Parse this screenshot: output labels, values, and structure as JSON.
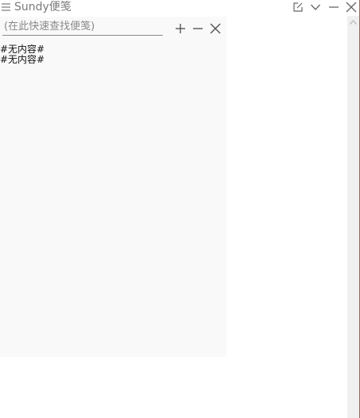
{
  "window": {
    "title": "Sundy便笺",
    "accent_border_color": "#d24b4b"
  },
  "titlebar": {
    "icons": [
      "menu-icon",
      "edit-icon",
      "chevron-down-icon",
      "minimize-icon",
      "close-icon"
    ]
  },
  "search": {
    "value": "",
    "placeholder": "(在此快速查找便笺)"
  },
  "panel": {
    "icons": [
      "add-icon",
      "remove-icon",
      "close-icon"
    ]
  },
  "notes": {
    "items": [
      "#无内容#",
      "#无内容#"
    ]
  }
}
